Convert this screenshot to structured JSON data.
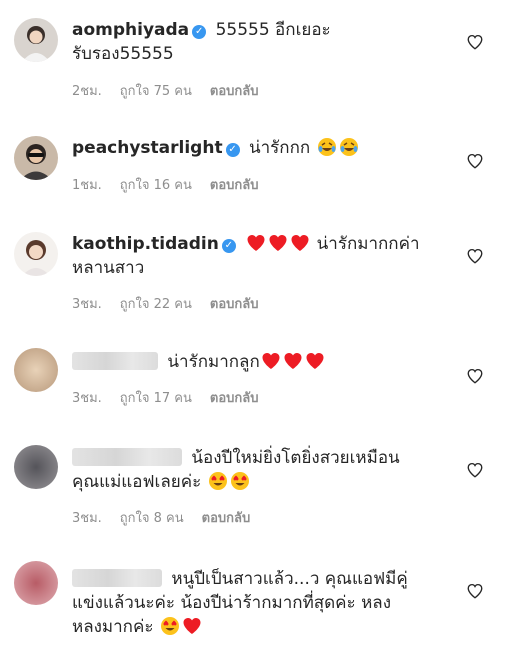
{
  "comments": [
    {
      "username": "aomphiyada",
      "verified": true,
      "text_line1": "55555 อีกเยอะ",
      "text_line2": "รับรอง55555",
      "time": "2ชม.",
      "likes": "ถูกใจ 75 คน",
      "reply": "ตอบกลับ"
    },
    {
      "username": "peachystarlight",
      "verified": true,
      "text_line1": "น่ารักกก",
      "time": "1ชม.",
      "likes": "ถูกใจ 16 คน",
      "reply": "ตอบกลับ"
    },
    {
      "username": "kaothip.tidadin",
      "verified": true,
      "text_line1": "น่ารักมากกค่า",
      "text_line2": "หลานสาว",
      "time": "3ชม.",
      "likes": "ถูกใจ 22 คน",
      "reply": "ตอบกลับ"
    },
    {
      "username": "",
      "verified": false,
      "text_line1": "น่ารักมากลูก",
      "time": "3ชม.",
      "likes": "ถูกใจ 17 คน",
      "reply": "ตอบกลับ"
    },
    {
      "username": "",
      "verified": false,
      "text_line1": "น้องปีใหม่ยิ่งโตยิ่งสวยเหมือน",
      "text_line2": "คุณแม่แอฟเลยค่ะ",
      "time": "3ชม.",
      "likes": "ถูกใจ 8 คน",
      "reply": "ตอบกลับ"
    },
    {
      "username": "",
      "verified": false,
      "text_line1": "หนูปีเป็นสาวแล้ว...ว คุณแอฟมีคู่",
      "text_line2": "แข่งแล้วนะค่ะ น้องปีน่าร้ากมากที่สุดค่ะ หลง",
      "text_line3": "หลงมากค่ะ"
    }
  ],
  "icons": {
    "verified": "verified-badge-icon",
    "like": "heart-outline-icon"
  },
  "colors": {
    "verified_blue": "#3897f0",
    "meta_gray": "#8e8e8e",
    "text": "#262626",
    "heart_red": "#ed1c24"
  }
}
